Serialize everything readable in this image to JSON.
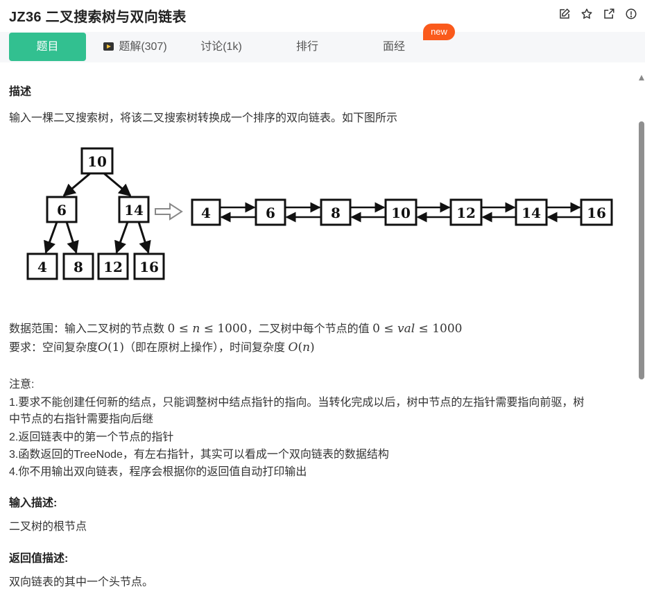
{
  "header": {
    "title": "JZ36  二叉搜索树与双向链表",
    "icons": [
      "edit-icon",
      "star-icon",
      "share-icon",
      "info-icon"
    ]
  },
  "tabs": [
    {
      "label": "题目",
      "active": true
    },
    {
      "label": "题解(307)",
      "active": false
    },
    {
      "label": "讨论(1k)",
      "active": false
    },
    {
      "label": "排行",
      "active": false
    },
    {
      "label": "面经",
      "active": false
    }
  ],
  "badge": "new",
  "description": {
    "heading": "描述",
    "intro": "输入一棵二叉搜索树，将该二叉搜索树转换成一个排序的双向链表。如下图所示",
    "tree": {
      "root": "10",
      "level1": [
        "6",
        "14"
      ],
      "level2": [
        "4",
        "8",
        "12",
        "16"
      ]
    },
    "list": [
      "4",
      "6",
      "8",
      "10",
      "12",
      "14",
      "16"
    ],
    "range_prefix": "数据范围：输入二叉树的节点数",
    "range_mid": "，二叉树中每个节点的值",
    "req_prefix": "要求：空间复杂度",
    "req_mid": "（即在原树上操作），时间复杂度",
    "note_title": "注意:",
    "note1a": "1.要求不能创建任何新的结点，只能调整树中结点指针的指向。当转化完成以后，树中节点的左指针需要指向前驱，树",
    "note1b": "中节点的右指针需要指向后继",
    "note2": "2.返回链表中的第一个节点的指针",
    "note3": "3.函数返回的TreeNode，有左右指针，其实可以看成一个双向链表的数据结构",
    "note4": "4.你不用输出双向链表，程序会根据你的返回值自动打印输出"
  },
  "input": {
    "heading": "输入描述:",
    "text": "二叉树的根节点"
  },
  "output": {
    "heading": "返回值描述:",
    "text": "双向链表的其中一个头节点。"
  },
  "colors": {
    "accent": "#32c090",
    "badge": "#fa5a1c"
  }
}
